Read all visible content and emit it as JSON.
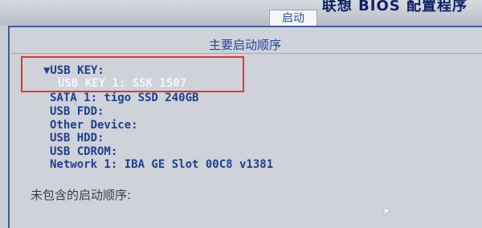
{
  "header": {
    "title": "联想 BIOS 配置程序",
    "active_tab": "启动"
  },
  "section": {
    "title": "主要启动顺序"
  },
  "boot_order": {
    "group": "▼USB KEY:",
    "items": [
      "USB KEY 1: SSK 1507",
      "SATA 1: tigo SSD 240GB",
      "USB FDD:",
      "Other Device:",
      "USB HDD:",
      "USB CDROM:",
      "Network 1: IBA GE Slot 00C8 v1381"
    ]
  },
  "excluded": {
    "title": "未包含的启动顺序:"
  },
  "overlay": {
    "cursor_icon": "arrow-cursor-icon",
    "highlight_color": "#e1372f"
  }
}
